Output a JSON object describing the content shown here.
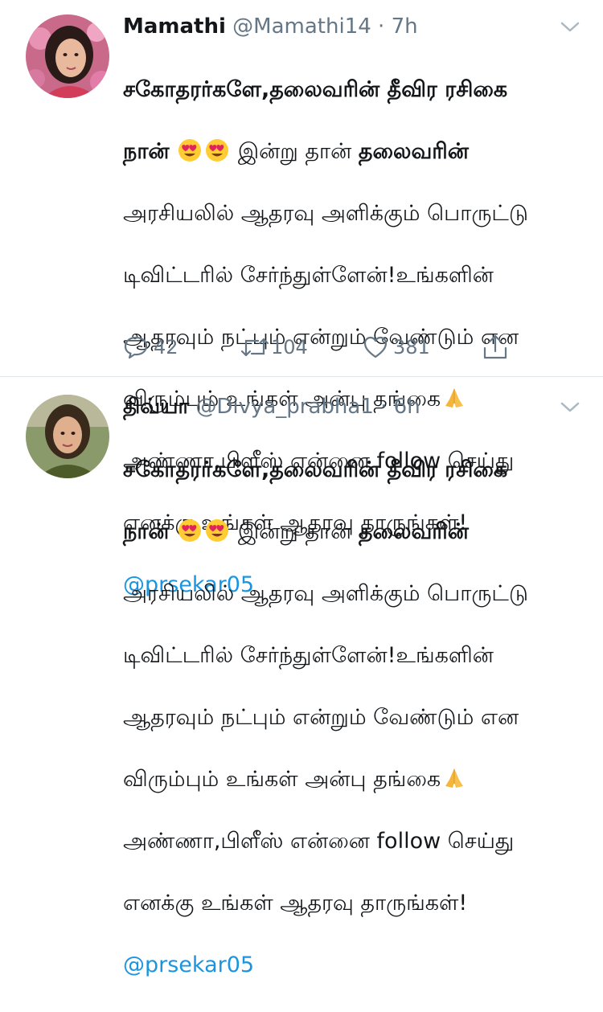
{
  "colors": {
    "link": "#1b95e0",
    "muted": "#657786",
    "text": "#14171a",
    "divider": "#e1e8ed"
  },
  "tweets": [
    {
      "display_name": "Mamathi",
      "handle": "@Mamathi14",
      "time": "7h",
      "lines": {
        "l1": "சகோதரர்களே,தலைவரின் தீவிர ரசிகை",
        "l2a": "நான்",
        "l2b": "இன்று தான்",
        "l2c": "தலைவரின்",
        "l3": "அரசியலில் ஆதரவு அளிக்கும் பொருட்டு",
        "l4": "டிவிட்டரில் சேர்ந்துள்ளேன்!உங்களின்",
        "l5": "ஆதரவும் நட்பும் என்றும் வேண்டும் என",
        "l6": "விரும்பும் உங்கள் அன்பு தங்கை",
        "l7": "அண்ணா,பிளீஸ் என்னை follow செய்து",
        "l8": "எனக்கு உங்கள் ஆதரவு தாருங்கள்!"
      },
      "mention": "@prsekar05",
      "stats": {
        "replies": "42",
        "retweets": "104",
        "likes": "381"
      },
      "icons": [
        "reply-icon",
        "retweet-icon",
        "like-icon",
        "share-icon",
        "chevron-down-icon",
        "heart-eyes-emoji",
        "folded-hands-emoji"
      ]
    },
    {
      "display_name": "திவ்யா",
      "handle": "@Divya_prabha1",
      "time": "6h",
      "lines": {
        "l1": "சகோதரர்களே,தலைவரின் தீவிர ரசிகை",
        "l2a": "நான்",
        "l2b": "இன்று தான்",
        "l2c": "தலைவரின்",
        "l3": "அரசியலில் ஆதரவு அளிக்கும் பொருட்டு",
        "l4": "டிவிட்டரில் சேர்ந்துள்ளேன்!உங்களின்",
        "l5": "ஆதரவும் நட்பும் என்றும் வேண்டும் என",
        "l6": "விரும்பும் உங்கள் அன்பு தங்கை",
        "l7": "அண்ணா,பிளீஸ் என்னை follow செய்து",
        "l8": "எனக்கு உங்கள் ஆதரவு தாருங்கள்!"
      },
      "mention": "@prsekar05"
    }
  ],
  "separator": "·"
}
